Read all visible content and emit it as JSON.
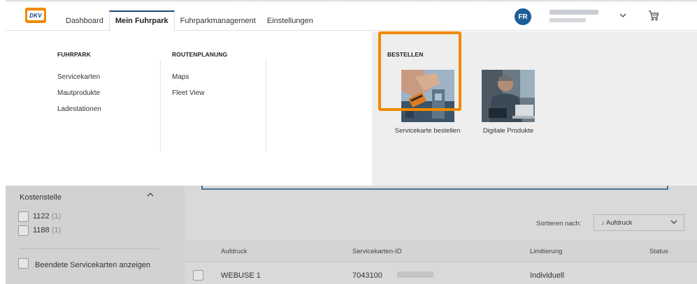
{
  "header": {
    "logo_text": "DKV",
    "tabs": [
      {
        "label": "Dashboard",
        "active": false
      },
      {
        "label": "Mein Fuhrpark",
        "active": true
      },
      {
        "label": "Fuhrparkmanagement",
        "active": false
      },
      {
        "label": "Einstellungen",
        "active": false
      }
    ],
    "avatar_initials": "FR",
    "icons": {
      "user_menu": "chevron-down-icon",
      "cart": "cart-icon"
    }
  },
  "menu": {
    "fuhrpark": {
      "heading": "FUHRPARK",
      "items": [
        "Servicekarten",
        "Mautprodukte",
        "Ladestationen"
      ]
    },
    "routenplanung": {
      "heading": "ROUTENPLANUNG",
      "items": [
        "Maps",
        "Fleet View"
      ]
    },
    "bestellen": {
      "heading": "BESTELLEN",
      "tiles": [
        {
          "label": "Servicekarte bestellen",
          "highlighted": true
        },
        {
          "label": "Digitale Produkte",
          "highlighted": false
        }
      ]
    }
  },
  "sidebar": {
    "filter_title": "Kostenstelle",
    "options": [
      {
        "value": "1122",
        "count": "(1)"
      },
      {
        "value": "1188",
        "count": "(1)"
      }
    ],
    "ended_cards_label": "Beendete Servicekarten anzeigen"
  },
  "sort": {
    "label": "Sortieren nach:",
    "selected": "↓ Aufdruck"
  },
  "table": {
    "columns": [
      "Aufdruck",
      "Servicekarten-ID",
      "Limitierung",
      "Status"
    ],
    "rows": [
      {
        "aufdruck": "WEBUSE 1",
        "id_prefix": "7043100",
        "limitierung": "Individuell",
        "status": ""
      }
    ]
  },
  "colors": {
    "accent_orange": "#f08a00",
    "brand_blue": "#1d5d97",
    "active_tab_border": "#1b4a7a"
  }
}
